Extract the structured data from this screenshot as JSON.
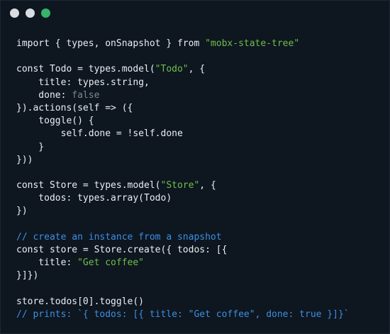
{
  "window": {
    "controls": [
      {
        "name": "close",
        "color": "#d9dde2"
      },
      {
        "name": "minimize",
        "color": "#d9dde2"
      },
      {
        "name": "zoom",
        "color": "#37b36a"
      }
    ]
  },
  "colors": {
    "background": "#0e1620",
    "text": "#e9eef3",
    "string": "#6fbf4a",
    "boolean": "#7a8796",
    "comment": "#3d8fe0"
  },
  "code": {
    "language": "javascript",
    "lines": [
      [
        {
          "t": "import { types, onSnapshot } from ",
          "k": "plain"
        },
        {
          "t": "\"mobx-state-tree\"",
          "k": "str"
        }
      ],
      [],
      [
        {
          "t": "const Todo = types.model(",
          "k": "plain"
        },
        {
          "t": "\"Todo\"",
          "k": "str"
        },
        {
          "t": ", {",
          "k": "plain"
        }
      ],
      [
        {
          "t": "    title: types.string,",
          "k": "plain"
        }
      ],
      [
        {
          "t": "    done: ",
          "k": "plain"
        },
        {
          "t": "false",
          "k": "bool"
        }
      ],
      [
        {
          "t": "}).actions(self => ({",
          "k": "plain"
        }
      ],
      [
        {
          "t": "    toggle() {",
          "k": "plain"
        }
      ],
      [
        {
          "t": "        self.done = !self.done",
          "k": "plain"
        }
      ],
      [
        {
          "t": "    }",
          "k": "plain"
        }
      ],
      [
        {
          "t": "}))",
          "k": "plain"
        }
      ],
      [],
      [
        {
          "t": "const Store = types.model(",
          "k": "plain"
        },
        {
          "t": "\"Store\"",
          "k": "str"
        },
        {
          "t": ", {",
          "k": "plain"
        }
      ],
      [
        {
          "t": "    todos: types.array(Todo)",
          "k": "plain"
        }
      ],
      [
        {
          "t": "})",
          "k": "plain"
        }
      ],
      [],
      [
        {
          "t": "// create an instance from a snapshot",
          "k": "comment"
        }
      ],
      [
        {
          "t": "const store = Store.create({ todos: [{",
          "k": "plain"
        }
      ],
      [
        {
          "t": "    title: ",
          "k": "plain"
        },
        {
          "t": "\"Get coffee\"",
          "k": "str"
        }
      ],
      [
        {
          "t": "}]})",
          "k": "plain"
        }
      ],
      [],
      [
        {
          "t": "store.todos[0].toggle()",
          "k": "plain"
        }
      ],
      [
        {
          "t": "// prints: `{ todos: [{ title: \"Get coffee\", done: true }]}`",
          "k": "comment"
        }
      ]
    ]
  }
}
